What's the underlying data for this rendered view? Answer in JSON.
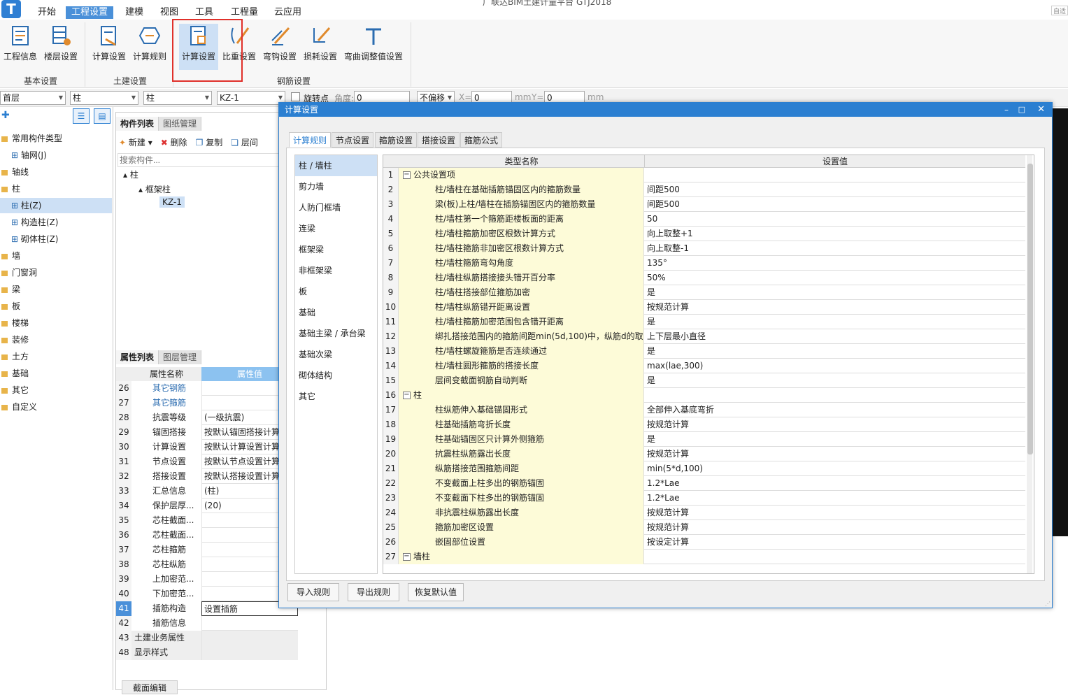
{
  "app": {
    "title_partial": "广联达BIM土建计量平台 GTJ2018",
    "right_box": "自适"
  },
  "menu": {
    "tabs": [
      "开始",
      "工程设置",
      "建模",
      "视图",
      "工具",
      "工程量",
      "云应用"
    ],
    "active": "工程设置"
  },
  "ribbon": {
    "buttons": [
      "工程信息",
      "楼层设置",
      "计算设置",
      "计算规则",
      "计算设置",
      "比重设置",
      "弯钩设置",
      "损耗设置",
      "弯曲调整值设置"
    ],
    "groups": [
      "基本设置",
      "土建设置",
      "钢筋设置"
    ]
  },
  "toolbar": {
    "floor": "首层",
    "type1": "柱",
    "type2": "柱",
    "component": "KZ-1",
    "rotate_label": "旋转点",
    "angle_label": "角度:",
    "angle_value": "0",
    "offset_select": "不偏移",
    "x_label": "X=",
    "x_value": "0",
    "mm1": "mm",
    "y_label": "Y=",
    "y_value": "0",
    "mm2": "mm"
  },
  "left_tree": {
    "items": [
      {
        "label": "常用构件类型",
        "level": 0
      },
      {
        "label": "轴网(J)",
        "level": 1
      },
      {
        "label": "轴线",
        "level": 0
      },
      {
        "label": "柱",
        "level": 0
      },
      {
        "label": "柱(Z)",
        "level": 1,
        "selected": true
      },
      {
        "label": "构造柱(Z)",
        "level": 1
      },
      {
        "label": "砌体柱(Z)",
        "level": 1
      },
      {
        "label": "墙",
        "level": 0
      },
      {
        "label": "门窗洞",
        "level": 0
      },
      {
        "label": "梁",
        "level": 0
      },
      {
        "label": "板",
        "level": 0
      },
      {
        "label": "楼梯",
        "level": 0
      },
      {
        "label": "装修",
        "level": 0
      },
      {
        "label": "土方",
        "level": 0
      },
      {
        "label": "基础",
        "level": 0
      },
      {
        "label": "其它",
        "level": 0
      },
      {
        "label": "自定义",
        "level": 0
      }
    ]
  },
  "component_panel": {
    "tabs": [
      "构件列表",
      "图纸管理"
    ],
    "actions": [
      "新建",
      "删除",
      "复制",
      "层间"
    ],
    "search_placeholder": "搜索构件...",
    "tree": [
      "柱",
      "框架柱",
      "KZ-1"
    ]
  },
  "property_panel": {
    "tabs": [
      "属性列表",
      "图层管理"
    ],
    "col_name": "属性名称",
    "col_value": "属性值",
    "rows": [
      {
        "n": "26",
        "name": "其它钢筋",
        "value": "",
        "link": true
      },
      {
        "n": "27",
        "name": "其它箍筋",
        "value": "",
        "link": true
      },
      {
        "n": "28",
        "name": "抗震等级",
        "value": "(一级抗震)"
      },
      {
        "n": "29",
        "name": "锚固搭接",
        "value": "按默认锚固搭接计算"
      },
      {
        "n": "30",
        "name": "计算设置",
        "value": "按默认计算设置计算"
      },
      {
        "n": "31",
        "name": "节点设置",
        "value": "按默认节点设置计算"
      },
      {
        "n": "32",
        "name": "搭接设置",
        "value": "按默认搭接设置计算"
      },
      {
        "n": "33",
        "name": "汇总信息",
        "value": "(柱)"
      },
      {
        "n": "34",
        "name": "保护层厚...",
        "value": "(20)"
      },
      {
        "n": "35",
        "name": "芯柱截面...",
        "value": ""
      },
      {
        "n": "36",
        "name": "芯柱截面...",
        "value": ""
      },
      {
        "n": "37",
        "name": "芯柱箍筋",
        "value": ""
      },
      {
        "n": "38",
        "name": "芯柱纵筋",
        "value": ""
      },
      {
        "n": "39",
        "name": "上加密范...",
        "value": ""
      },
      {
        "n": "40",
        "name": "下加密范...",
        "value": ""
      },
      {
        "n": "41",
        "name": "插筋构造",
        "value": "设置插筋",
        "selected": true
      },
      {
        "n": "42",
        "name": "插筋信息",
        "value": ""
      },
      {
        "n": "43",
        "name": "土建业务属性",
        "value": "",
        "group": true
      },
      {
        "n": "48",
        "name": "显示样式",
        "value": "",
        "group": true
      }
    ],
    "bottom_tab": "截面编辑"
  },
  "dialog": {
    "title": "计算设置",
    "tabs": [
      "计算规则",
      "节点设置",
      "箍筋设置",
      "搭接设置",
      "箍筋公式"
    ],
    "categories": [
      "柱 / 墙柱",
      "剪力墙",
      "人防门框墙",
      "连梁",
      "框架梁",
      "非框架梁",
      "板",
      "基础",
      "基础主梁 / 承台梁",
      "基础次梁",
      "砌体结构",
      "其它"
    ],
    "col_name": "类型名称",
    "col_value": "设置值",
    "rows": [
      {
        "n": "1",
        "name": "公共设置项",
        "value": "",
        "group": true
      },
      {
        "n": "2",
        "name": "柱/墙柱在基础插筋锚固区内的箍筋数量",
        "value": "间距500"
      },
      {
        "n": "3",
        "name": "梁(板)上柱/墙柱在插筋锚固区内的箍筋数量",
        "value": "间距500"
      },
      {
        "n": "4",
        "name": "柱/墙柱第一个箍筋距楼板面的距离",
        "value": "50"
      },
      {
        "n": "5",
        "name": "柱/墙柱箍筋加密区根数计算方式",
        "value": "向上取整+1"
      },
      {
        "n": "6",
        "name": "柱/墙柱箍筋非加密区根数计算方式",
        "value": "向上取整-1"
      },
      {
        "n": "7",
        "name": "柱/墙柱箍筋弯勾角度",
        "value": "135°"
      },
      {
        "n": "8",
        "name": "柱/墙柱纵筋搭接接头错开百分率",
        "value": "50%"
      },
      {
        "n": "9",
        "name": "柱/墙柱搭接部位箍筋加密",
        "value": "是"
      },
      {
        "n": "10",
        "name": "柱/墙柱纵筋错开距离设置",
        "value": "按规范计算"
      },
      {
        "n": "11",
        "name": "柱/墙柱箍筋加密范围包含错开距离",
        "value": "是"
      },
      {
        "n": "12",
        "name": "绑扎搭接范围内的箍筋间距min(5d,100)中，纵筋d的取值",
        "value": "上下层最小直径"
      },
      {
        "n": "13",
        "name": "柱/墙柱螺旋箍筋是否连续通过",
        "value": "是"
      },
      {
        "n": "14",
        "name": "柱/墙柱圆形箍筋的搭接长度",
        "value": "max(lae,300)"
      },
      {
        "n": "15",
        "name": "层间变截面钢筋自动判断",
        "value": "是"
      },
      {
        "n": "16",
        "name": "柱",
        "value": "",
        "group": true
      },
      {
        "n": "17",
        "name": "柱纵筋伸入基础锚固形式",
        "value": "全部伸入基底弯折"
      },
      {
        "n": "18",
        "name": "柱基础插筋弯折长度",
        "value": "按规范计算"
      },
      {
        "n": "19",
        "name": "柱基础锚固区只计算外侧箍筋",
        "value": "是"
      },
      {
        "n": "20",
        "name": "抗震柱纵筋露出长度",
        "value": "按规范计算"
      },
      {
        "n": "21",
        "name": "纵筋搭接范围箍筋间距",
        "value": "min(5*d,100)"
      },
      {
        "n": "22",
        "name": "不变截面上柱多出的钢筋锚固",
        "value": "1.2*Lae"
      },
      {
        "n": "23",
        "name": "不变截面下柱多出的钢筋锚固",
        "value": "1.2*Lae"
      },
      {
        "n": "24",
        "name": "非抗震柱纵筋露出长度",
        "value": "按规范计算"
      },
      {
        "n": "25",
        "name": "箍筋加密区设置",
        "value": "按规范计算"
      },
      {
        "n": "26",
        "name": "嵌固部位设置",
        "value": "按设定计算"
      },
      {
        "n": "27",
        "name": "墙柱",
        "value": "",
        "group": true
      }
    ],
    "buttons": [
      "导入规则",
      "导出规则",
      "恢复默认值"
    ]
  },
  "colors": {
    "accent": "#2b7fd1",
    "highlight": "#cde0f5",
    "name_cell": "#fdfbd8",
    "red_box": "#e0302a"
  }
}
